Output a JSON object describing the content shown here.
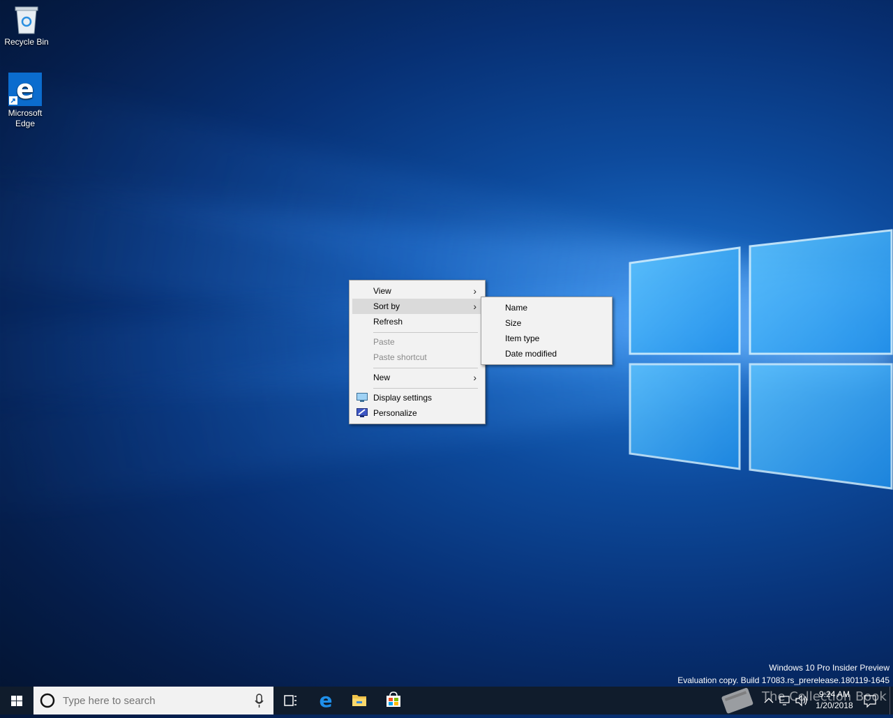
{
  "desktop_icons": [
    {
      "label": "Recycle Bin",
      "icon": "recycle-bin-icon"
    },
    {
      "label": "Microsoft Edge",
      "label_line1": "Microsoft",
      "label_line2": "Edge",
      "icon": "edge-icon"
    }
  ],
  "context_menu": {
    "items": [
      {
        "label": "View",
        "submenu": true
      },
      {
        "label": "Sort by",
        "submenu": true,
        "highlighted": true
      },
      {
        "label": "Refresh"
      },
      {
        "label": "Paste",
        "disabled": true
      },
      {
        "label": "Paste shortcut",
        "disabled": true
      },
      {
        "label": "New",
        "submenu": true
      },
      {
        "label": "Display settings",
        "icon": "display-settings-icon"
      },
      {
        "label": "Personalize",
        "icon": "personalize-icon"
      }
    ]
  },
  "sort_submenu": {
    "items": [
      {
        "label": "Name"
      },
      {
        "label": "Size"
      },
      {
        "label": "Item type"
      },
      {
        "label": "Date modified"
      }
    ]
  },
  "watermark": {
    "line1": "Windows 10 Pro Insider Preview",
    "line2": "Evaluation copy. Build 17083.rs_prerelease.180119-1645"
  },
  "taskbar": {
    "search_placeholder": "Type here to search",
    "pinned": [
      "task-view-icon",
      "edge-icon",
      "file-explorer-icon",
      "store-icon"
    ],
    "clock_time": "9:24 AM",
    "clock_date": "1/20/2018"
  },
  "branding": {
    "text": "The Collection Book"
  },
  "colors": {
    "accent": "#0078d7",
    "taskbar": "#101c2c",
    "menu_bg": "#f2f2f2"
  }
}
